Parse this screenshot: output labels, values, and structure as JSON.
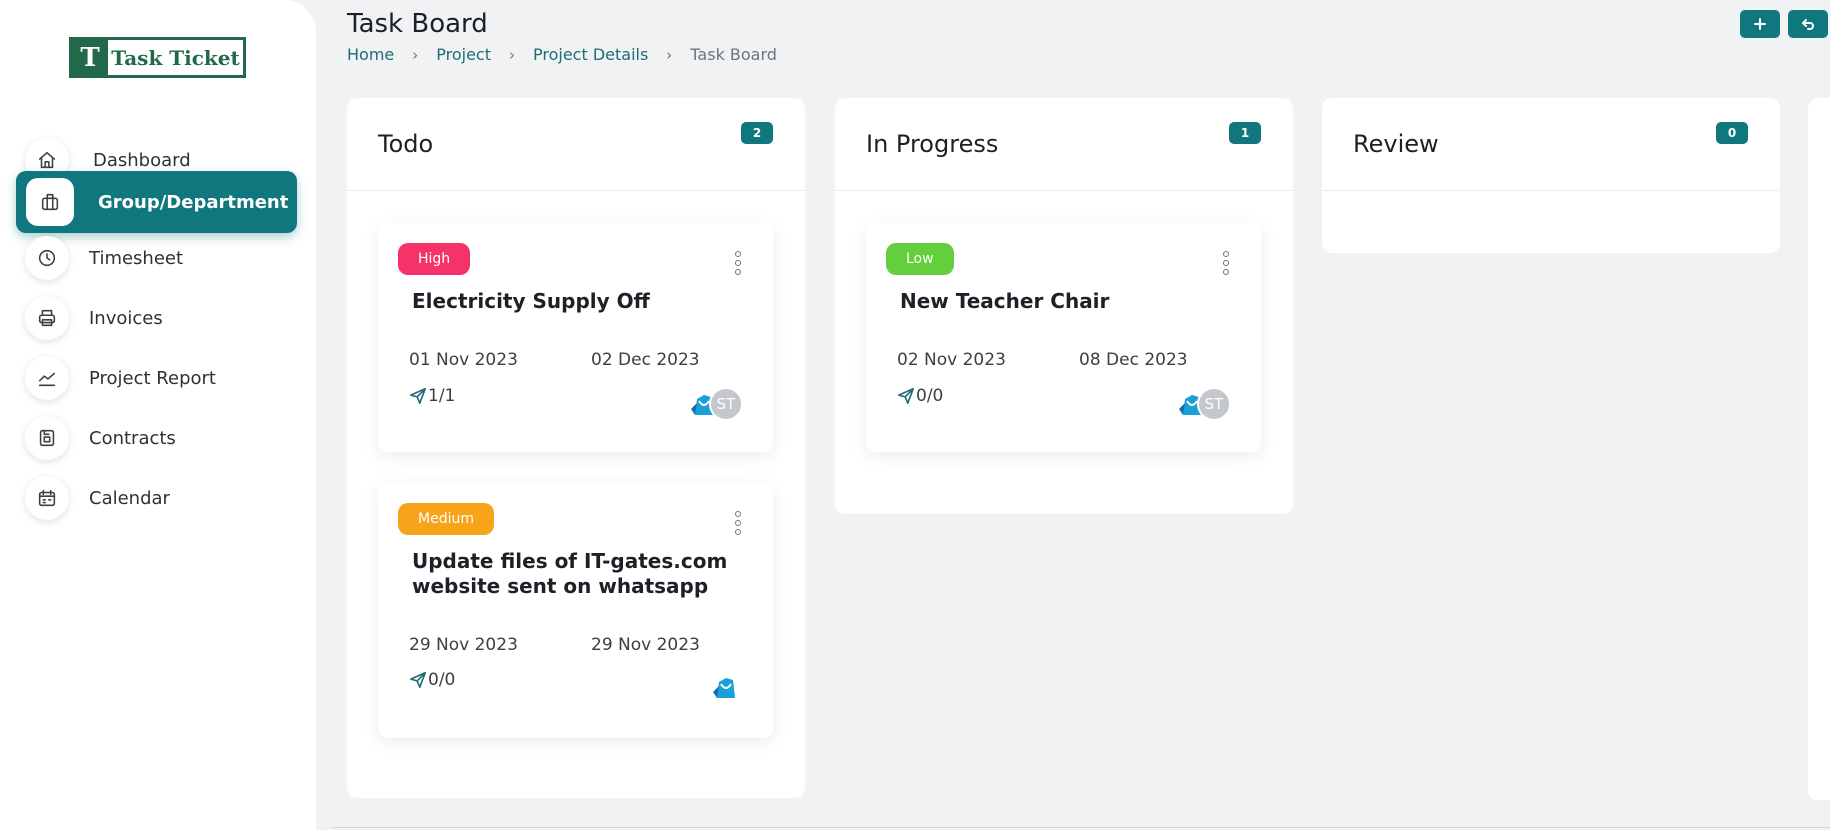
{
  "brand": {
    "logo_letter": "T",
    "name": "Task Ticket",
    "color": "#22694a"
  },
  "sidebar": {
    "items": [
      {
        "label": "Dashboard",
        "icon": "home-icon",
        "active": false
      },
      {
        "label": "Group/Department",
        "icon": "building-icon",
        "active": true
      },
      {
        "label": "Timesheet",
        "icon": "clock-icon",
        "active": false
      },
      {
        "label": "Invoices",
        "icon": "printer-icon",
        "active": false
      },
      {
        "label": "Project Report",
        "icon": "chart-line-icon",
        "active": false
      },
      {
        "label": "Contracts",
        "icon": "document-icon",
        "active": false
      },
      {
        "label": "Calendar",
        "icon": "calendar-icon",
        "active": false
      }
    ]
  },
  "header": {
    "title": "Task Board",
    "breadcrumb": [
      "Home",
      "Project",
      "Project Details",
      "Task Board"
    ],
    "actions": [
      {
        "icon": "plus-icon"
      },
      {
        "icon": "undo-icon"
      }
    ]
  },
  "accent_color": "#10777e",
  "columns": [
    {
      "title": "Todo",
      "count": "2",
      "cards": [
        {
          "priority": "High",
          "title": "Electricity Supply Off",
          "start": "01 Nov 2023",
          "end": "02 Dec 2023",
          "progress": "1/1",
          "assignees": [
            "avatar-icon",
            "ST"
          ]
        },
        {
          "priority": "Medium",
          "title": "Update files of IT-gates.com website sent on whatsapp",
          "start": "29 Nov 2023",
          "end": "29 Nov 2023",
          "progress": "0/0",
          "assignees": [
            "avatar-icon"
          ]
        }
      ]
    },
    {
      "title": "In Progress",
      "count": "1",
      "cards": [
        {
          "priority": "Low",
          "title": "New Teacher Chair",
          "start": "02 Nov 2023",
          "end": "08 Dec 2023",
          "progress": "0/0",
          "assignees": [
            "avatar-icon",
            "ST"
          ]
        }
      ]
    },
    {
      "title": "Review",
      "count": "0",
      "cards": []
    }
  ],
  "priority_colors": {
    "High": "#f5336a",
    "Medium": "#f8a41a",
    "Low": "#63cf3c"
  }
}
